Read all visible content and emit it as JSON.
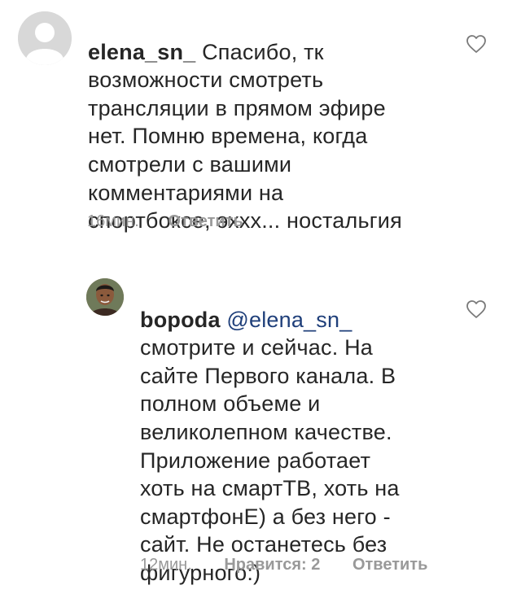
{
  "comments": [
    {
      "username": "elena_sn_",
      "text": " Спасибо, тк\nвозможности смотреть\nтрансляции в прямом эфире\nнет. Помню времена, когда\nсмотрели с вашими\nкомментариями на\nспортбоксе, эххх... ностальгия",
      "time": "16мин.",
      "reply_label": "Ответить",
      "like_icon": "heart-outline-icon",
      "avatar_icon": "default-profile-icon"
    },
    {
      "username": "bopoda",
      "mention": "@elena_sn_",
      "text": "\nсмотрите и сейчас. На\nсайте Первого канала. В\nполном объеме и\nвеликолепном качестве.\nПриложение работает\nхоть на смартТВ, хоть на\nсмартфонЕ) а без него -\nсайт. Не останетесь без\nфигурного:)",
      "time": "12мин.",
      "likes_label": "Нравится: 2",
      "reply_label": "Ответить",
      "like_icon": "heart-outline-icon",
      "avatar_icon": "user-photo-avatar"
    }
  ]
}
